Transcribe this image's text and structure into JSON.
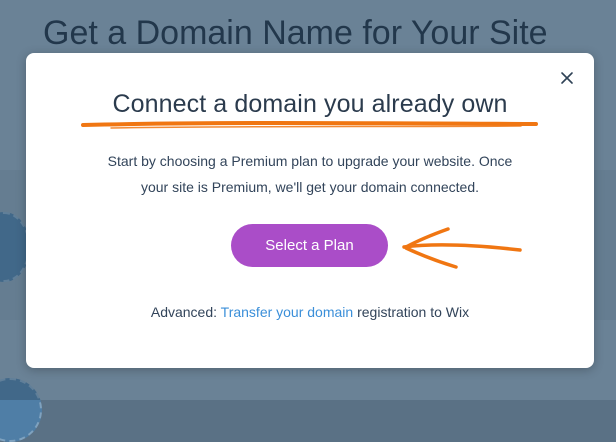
{
  "background": {
    "page_title": "Get a Domain Name for Your Site"
  },
  "modal": {
    "title": "Connect a domain you already own",
    "description_line1": "Start by choosing a Premium plan to upgrade your website. Once",
    "description_line2": "your site is Premium, we'll get your domain connected.",
    "cta_label": "Select a Plan",
    "advanced_prefix": "Advanced: ",
    "advanced_link": "Transfer your domain",
    "advanced_suffix": " registration to Wix"
  },
  "colors": {
    "cta": "#aa4dc8",
    "link": "#3b8fd9",
    "annotation": "#f07612",
    "title_text": "#2b3b4d"
  },
  "icons": {
    "close": "close-icon",
    "annotation_arrow": "arrow-left-icon",
    "annotation_underline": "underline-stroke"
  }
}
